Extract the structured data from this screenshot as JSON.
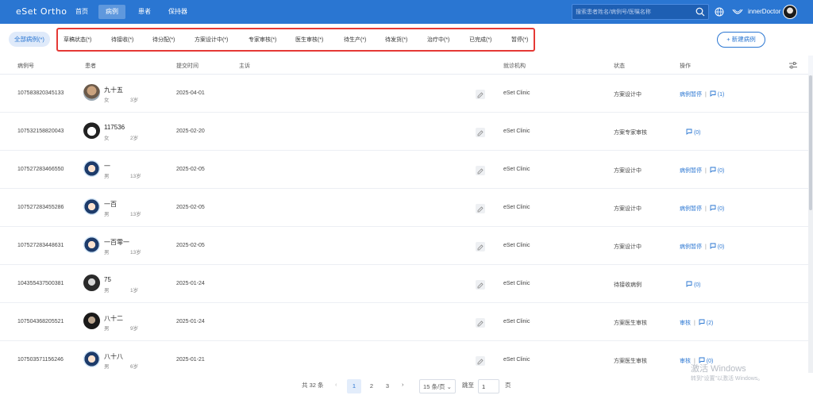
{
  "header": {
    "logo": "eSet Ortho",
    "nav": [
      "首页",
      "病例",
      "患者",
      "保持器"
    ],
    "search_placeholder": "搜索患者姓名/病例号/医嘱名称",
    "username": "innerDoctor"
  },
  "filters": {
    "all_label": "全部病例(*)",
    "statuses": [
      "草稿状态(*)",
      "待接收(*)",
      "待分配(*)",
      "方案设计中(*)",
      "专家审核(*)",
      "医生审核(*)",
      "待生产(*)",
      "待发货(*)",
      "治疗中(*)",
      "已完成(*)",
      "暂停(*)"
    ],
    "new_case_label": "+ 新建病例"
  },
  "table": {
    "headers": [
      "病例号",
      "患者",
      "提交时间",
      "主诉",
      "就诊机构",
      "状态",
      "操作"
    ],
    "rows": [
      {
        "case_no": "107583820345133",
        "name": "九十五",
        "gender": "女",
        "age": "3岁",
        "date": "2025-04-01",
        "clinic": "eSet Clinic",
        "status": "方案设计中",
        "action": "病例暂停",
        "sep": "|",
        "comments": "(1)"
      },
      {
        "case_no": "107532158820043",
        "name": "117536",
        "gender": "女",
        "age": "2岁",
        "date": "2025-02-20",
        "clinic": "eSet Clinic",
        "status": "方案专家审核",
        "action": "",
        "sep": "",
        "comments": "(0)"
      },
      {
        "case_no": "107527283466550",
        "name": "一",
        "gender": "男",
        "age": "13岁",
        "date": "2025-02-05",
        "clinic": "eSet Clinic",
        "status": "方案设计中",
        "action": "病例暂停",
        "sep": "|",
        "comments": "(0)"
      },
      {
        "case_no": "107527283455286",
        "name": "一百",
        "gender": "男",
        "age": "13岁",
        "date": "2025-02-05",
        "clinic": "eSet Clinic",
        "status": "方案设计中",
        "action": "病例暂停",
        "sep": "|",
        "comments": "(0)"
      },
      {
        "case_no": "107527283448631",
        "name": "一百零一",
        "gender": "男",
        "age": "13岁",
        "date": "2025-02-05",
        "clinic": "eSet Clinic",
        "status": "方案设计中",
        "action": "病例暂停",
        "sep": "|",
        "comments": "(0)"
      },
      {
        "case_no": "104355437500381",
        "name": "75",
        "gender": "男",
        "age": "1岁",
        "date": "2025-01-24",
        "clinic": "eSet Clinic",
        "status": "待接收病例",
        "action": "",
        "sep": "",
        "comments": "(0)"
      },
      {
        "case_no": "107504368205521",
        "name": "八十二",
        "gender": "男",
        "age": "9岁",
        "date": "2025-01-24",
        "clinic": "eSet Clinic",
        "status": "方案医生审核",
        "action": "审核",
        "sep": "|",
        "comments": "(2)"
      },
      {
        "case_no": "107503571156246",
        "name": "八十八",
        "gender": "男",
        "age": "6岁",
        "date": "2025-01-21",
        "clinic": "eSet Clinic",
        "status": "方案医生审核",
        "action": "审核",
        "sep": "|",
        "comments": "(0)"
      }
    ]
  },
  "pagination": {
    "total": "共 32 条",
    "pages": [
      "1",
      "2",
      "3"
    ],
    "current": "1",
    "page_size": "15 条/页",
    "jump_label": "跳至",
    "jump_value": "1",
    "page_suffix": "页"
  },
  "watermark": {
    "line1": "激活 Windows",
    "line2": "转到\"设置\"以激活 Windows。"
  },
  "colors": {
    "primary": "#2a76d2",
    "highlight_border": "#e53935"
  }
}
